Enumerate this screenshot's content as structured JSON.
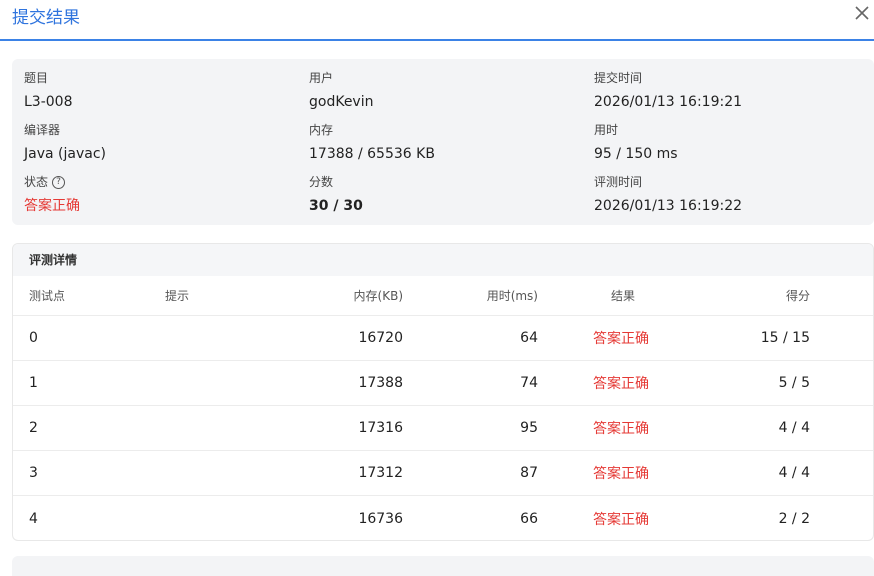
{
  "dialog": {
    "title": "提交结果",
    "close_icon": "close-icon"
  },
  "info": {
    "problem_label": "题目",
    "problem_value": "L3-008",
    "user_label": "用户",
    "user_value": "godKevin",
    "submit_time_label": "提交时间",
    "submit_time_value": "2026/01/13 16:19:21",
    "compiler_label": "编译器",
    "compiler_value": "Java (javac)",
    "memory_label": "内存",
    "memory_value": "17388 / 65536 KB",
    "time_label": "用时",
    "time_value": "95 / 150 ms",
    "status_label": "状态",
    "status_value": "答案正确",
    "status_help_icon": "question-circle-icon",
    "score_label": "分数",
    "score_value": "30 / 30",
    "judge_time_label": "评测时间",
    "judge_time_value": "2026/01/13 16:19:22"
  },
  "details": {
    "title": "评测详情",
    "columns": {
      "case": "测试点",
      "hint": "提示",
      "memory": "内存(KB)",
      "time": "用时(ms)",
      "result": "结果",
      "score": "得分"
    },
    "rows": [
      {
        "case": "0",
        "hint": "",
        "memory": "16720",
        "time": "64",
        "result": "答案正确",
        "score": "15 / 15"
      },
      {
        "case": "1",
        "hint": "",
        "memory": "17388",
        "time": "74",
        "result": "答案正确",
        "score": "5 / 5"
      },
      {
        "case": "2",
        "hint": "",
        "memory": "17316",
        "time": "95",
        "result": "答案正确",
        "score": "4 / 4"
      },
      {
        "case": "3",
        "hint": "",
        "memory": "17312",
        "time": "87",
        "result": "答案正确",
        "score": "4 / 4"
      },
      {
        "case": "4",
        "hint": "",
        "memory": "16736",
        "time": "66",
        "result": "答案正确",
        "score": "2 / 2"
      }
    ]
  },
  "colors": {
    "accent": "#2f74de",
    "success_text": "#e53935"
  }
}
